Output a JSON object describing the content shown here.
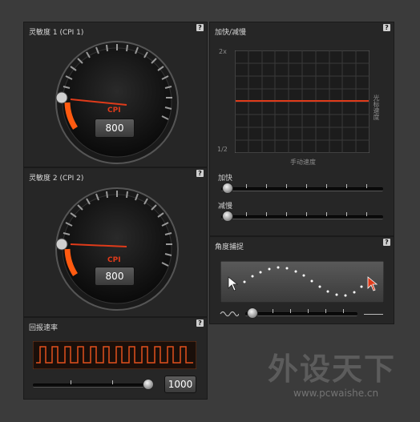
{
  "sens1": {
    "title": "灵敏度 1 (CPI 1)",
    "cpi_label": "CPI",
    "value": "800",
    "help": "?"
  },
  "sens2": {
    "title": "灵敏度 2 (CPI 2)",
    "cpi_label": "CPI",
    "value": "800",
    "help": "?"
  },
  "polling": {
    "title": "回报速率",
    "value": "1000",
    "help": "?"
  },
  "accel": {
    "title": "加快/减慢",
    "y_top": "2x",
    "y_bottom": "1/2",
    "x_label": "手动速度",
    "y_label": "光标速度",
    "help": "?",
    "accelerate_label": "加快",
    "decelerate_label": "减慢"
  },
  "angle": {
    "title": "角度捕捉",
    "help": "?"
  },
  "watermark": {
    "brand": "外设天下",
    "url": "www.pcwaishe.cn"
  },
  "colors": {
    "accent": "#e03b1a",
    "orange": "#ff5a10",
    "panel": "#262626",
    "background": "#3b3b3b"
  }
}
